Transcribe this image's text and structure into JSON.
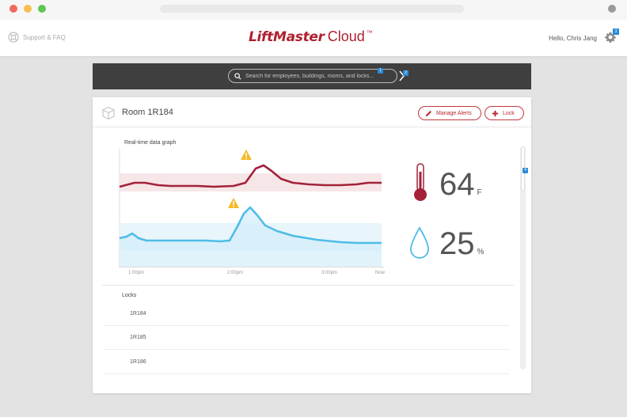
{
  "header": {
    "support_label": "Support & FAQ",
    "brand_main": "LiftMaster",
    "brand_sub": "Cloud",
    "brand_tm": "™",
    "greeting": "Hello, Chris Jang",
    "settings_badge": "3"
  },
  "search": {
    "placeholder": "Search for employees, buildings, rooms, and locks...",
    "badge_1": "1",
    "badge_2": "2"
  },
  "room": {
    "title": "Room 1R184",
    "manage_alerts_label": "Manage Alerts",
    "lock_label": "Lock"
  },
  "graph": {
    "label": "Real-time data graph",
    "x_ticks": [
      "1:00pm",
      "2:00pm",
      "3:00pm",
      "Now"
    ]
  },
  "readings": {
    "temperature_value": "64",
    "temperature_unit": "F",
    "humidity_value": "25",
    "humidity_unit": "%"
  },
  "scroll_badge": "4",
  "locks": {
    "title": "Locks",
    "items": [
      {
        "label": "1R184"
      },
      {
        "label": "1R185"
      },
      {
        "label": "1R186"
      }
    ]
  },
  "colors": {
    "brand_red": "#b01f2e",
    "temperature_line": "#a3223a",
    "humidity_line": "#4dbde8",
    "alert_yellow": "#f5b923",
    "badge_blue": "#2a8ad8"
  }
}
